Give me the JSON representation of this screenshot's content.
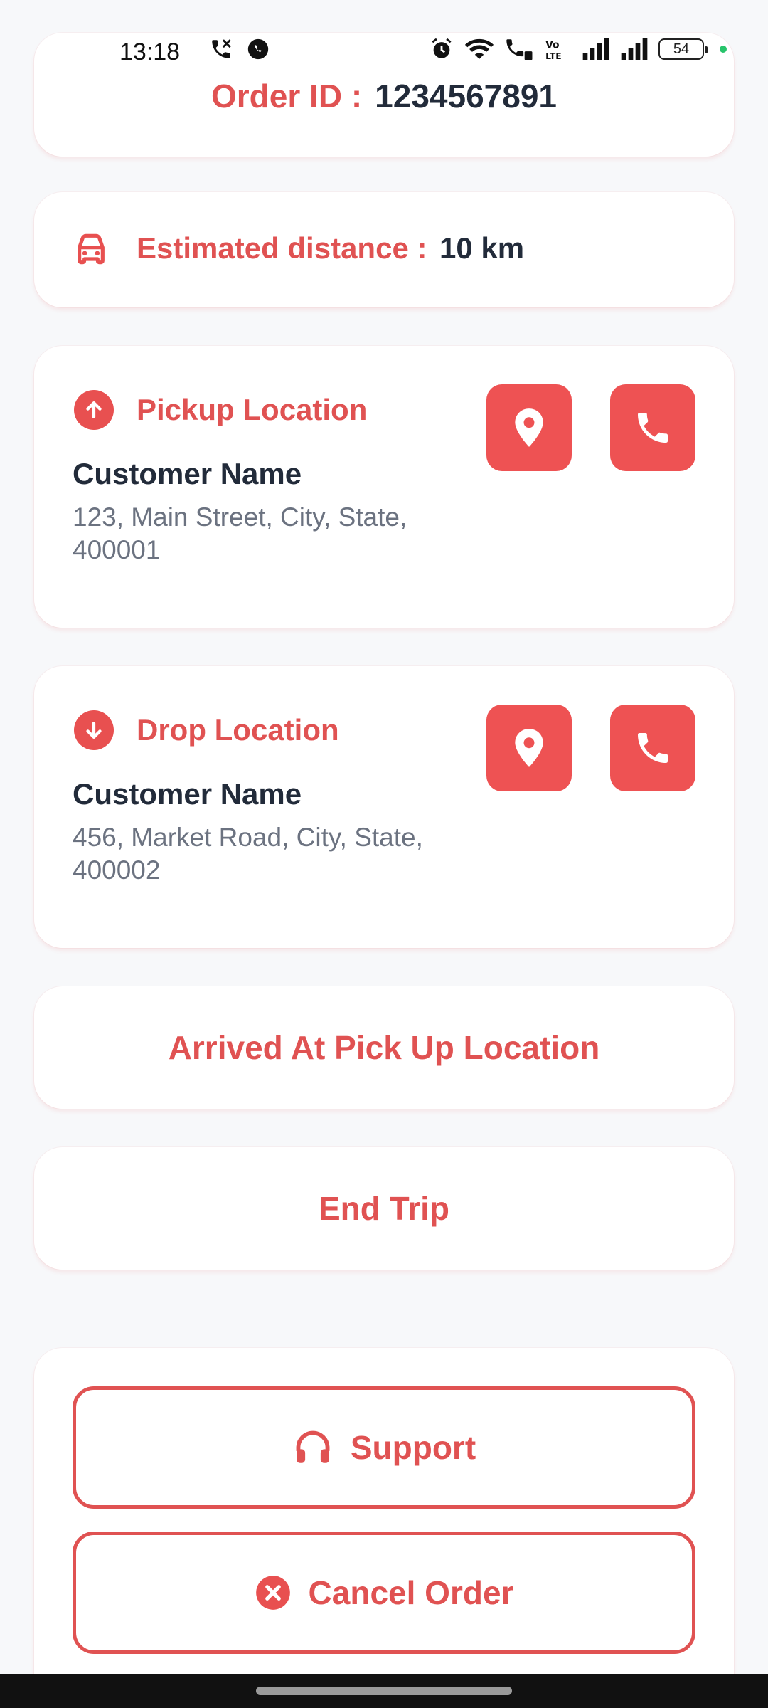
{
  "status_bar": {
    "time": "13:18",
    "battery": "54"
  },
  "order": {
    "label": "Order ID :",
    "value": "1234567891"
  },
  "distance": {
    "label": "Estimated distance :",
    "value": "10 km",
    "icon": "car-icon"
  },
  "pickup": {
    "title": "Pickup Location",
    "customer_name": "Customer Name",
    "address": "123, Main Street, City, State, 400001",
    "icon": "arrow-up-circle-icon"
  },
  "drop": {
    "title": "Drop Location",
    "customer_name": "Customer Name",
    "address": "456, Market Road, City, State, 400002",
    "icon": "arrow-down-circle-icon"
  },
  "actions": {
    "arrived": "Arrived At Pick Up Location",
    "end_trip": "End Trip"
  },
  "bottom": {
    "support": "Support",
    "cancel": "Cancel Order"
  },
  "colors": {
    "accent": "#e05252",
    "button_fill": "#ee5253",
    "text_dark": "#222b3a",
    "text_muted": "#6b7280",
    "background": "#f7f8fa"
  }
}
